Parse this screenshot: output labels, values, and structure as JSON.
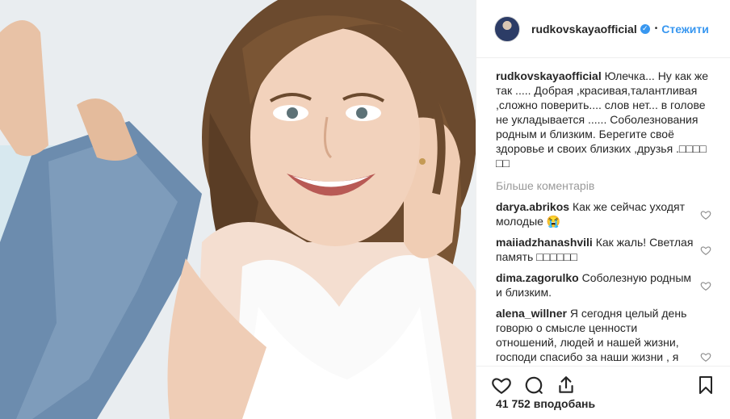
{
  "post": {
    "username": "rudkovskayaofficial",
    "follow_label": "Стежити",
    "separator": "•",
    "caption_text": "Юлечка... Ну как же так ..... Добрая ,красивая,талантливая ,сложно поверить.... слов нет... в голове не укладывается ...... Соболезнования родным и близким. Берегите своё здоровье и своих близких ,друзья .□□□□ □□",
    "more_comments_label": "Більше коментарів",
    "likes_text": "41 752 вподобань"
  },
  "comments": [
    {
      "username": "darya.abrikos",
      "text": "Как же сейчас уходят молодые 😭"
    },
    {
      "username": "maiiadzhanashvili",
      "text": "Как жаль! Светлая память □□□□□□"
    },
    {
      "username": "dima.zagorulko",
      "text": "Соболезную родным и близким."
    },
    {
      "username": "alena_willner",
      "text": "Я сегодня целый день говорю о смысле ценности отношений, людей и нашей жизни, господи спасибо за наши жизни , я"
    }
  ],
  "icons": {
    "verified": "verified-badge-icon",
    "like": "heart-icon",
    "comment": "comment-bubble-icon",
    "share": "share-icon",
    "save": "bookmark-icon"
  },
  "colors": {
    "link": "#3897f0",
    "text": "#262626",
    "muted": "#999999",
    "border": "#efefef"
  }
}
